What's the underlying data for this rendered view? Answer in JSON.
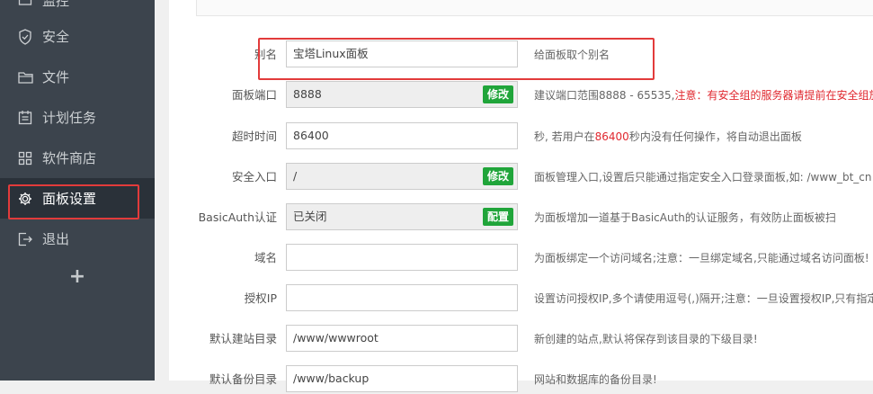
{
  "sidebar": {
    "items": [
      {
        "label": "监控",
        "icon": "monitor-icon"
      },
      {
        "label": "安全",
        "icon": "shield-icon"
      },
      {
        "label": "文件",
        "icon": "folder-icon"
      },
      {
        "label": "计划任务",
        "icon": "calendar-icon"
      },
      {
        "label": "软件商店",
        "icon": "grid-icon"
      },
      {
        "label": "面板设置",
        "icon": "gear-icon",
        "active": true
      },
      {
        "label": "退出",
        "icon": "logout-icon"
      }
    ],
    "add_label": "+"
  },
  "settings": {
    "alias": {
      "label": "别名",
      "value": "宝塔Linux面板",
      "desc": "给面板取个别名"
    },
    "port": {
      "label": "面板端口",
      "value": "8888",
      "button": "修改",
      "desc": "建议端口范围8888 - 65535,",
      "desc_warn": "注意：有安全组的服务器请提前在安全组放行"
    },
    "timeout": {
      "label": "超时时间",
      "value": "86400",
      "desc_pre": "秒, 若用户在",
      "desc_highlight": "86400",
      "desc_post": "秒内没有任何操作，将自动退出面板"
    },
    "entry": {
      "label": "安全入口",
      "value": "/",
      "button": "修改",
      "desc": "面板管理入口,设置后只能通过指定安全入口登录面板,如: /www_bt_cn"
    },
    "basicauth": {
      "label": "BasicAuth认证",
      "value": "已关闭",
      "button": "配置",
      "desc": "为面板增加一道基于BasicAuth的认证服务，有效防止面板被扫"
    },
    "domain": {
      "label": "域名",
      "value": "",
      "desc": "为面板绑定一个访问域名;注意：一旦绑定域名,只能通过域名访问面板!"
    },
    "authip": {
      "label": "授权IP",
      "value": "",
      "desc": "设置访问授权IP,多个请使用逗号(,)隔开;注意：一旦设置授权IP,只有指定IP的"
    },
    "site_dir": {
      "label": "默认建站目录",
      "value": "/www/wwwroot",
      "desc": "新创建的站点,默认将保存到该目录的下级目录!"
    },
    "backup_dir": {
      "label": "默认备份目录",
      "value": "/www/backup",
      "desc": "网站和数据库的备份目录!"
    }
  },
  "colors": {
    "sidebar_bg": "#3c444d",
    "active_bg": "#2a3139",
    "button_green": "#20a53a",
    "highlight_red": "#e23b3b"
  }
}
